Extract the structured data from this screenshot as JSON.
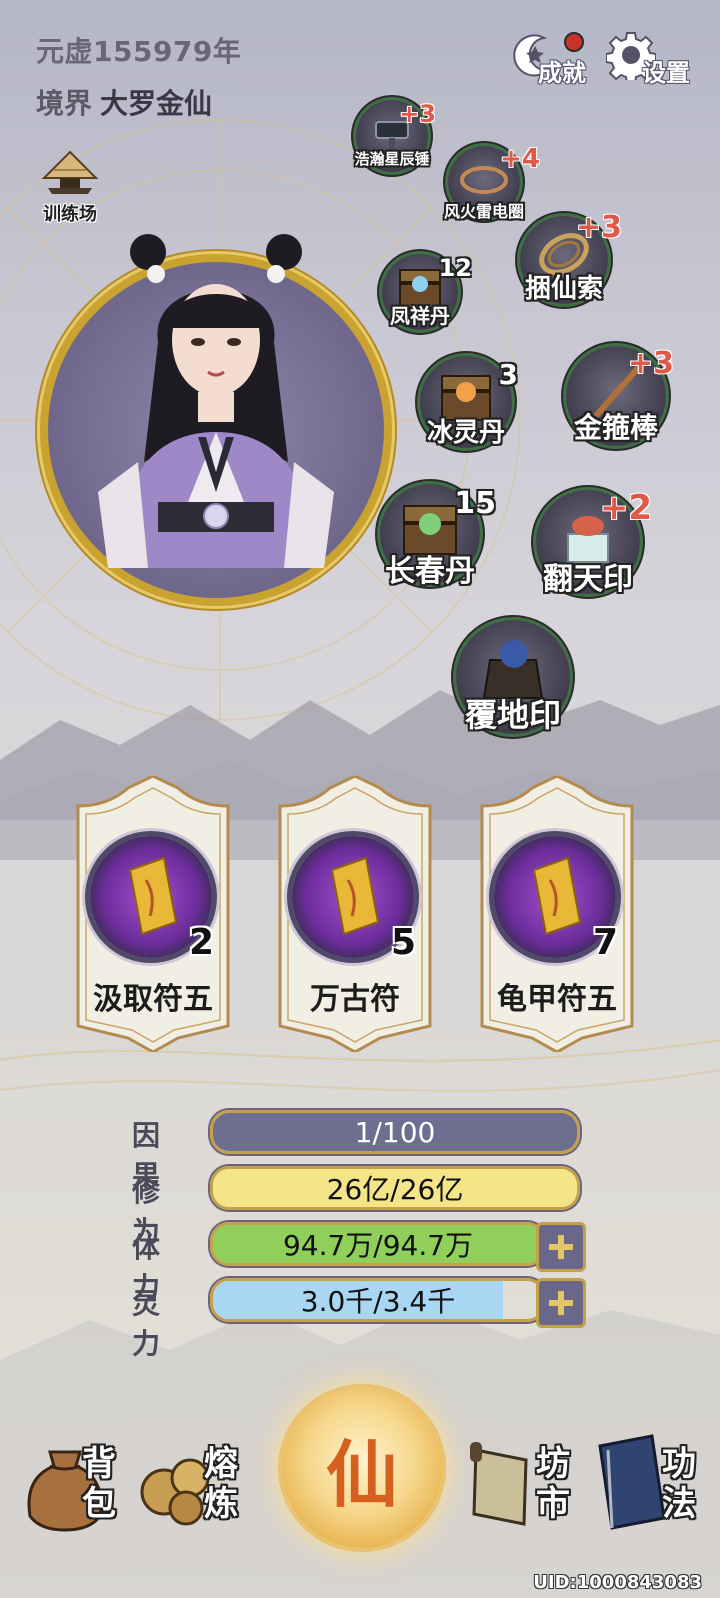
{
  "header": {
    "year": "元虚155979年",
    "realm_label": "境界",
    "realm_value": "大罗金仙",
    "achievement_label": "成就",
    "settings_label": "设置",
    "training_label": "训练场"
  },
  "items": [
    {
      "name": "浩瀚星辰锤",
      "badge": "+3"
    },
    {
      "name": "风火雷电圈",
      "badge": "+4"
    },
    {
      "name": "捆仙索",
      "badge": "+3"
    },
    {
      "name": "凤祥丹",
      "badge": "12"
    },
    {
      "name": "冰灵丹",
      "badge": "3"
    },
    {
      "name": "金箍棒",
      "badge": "+3"
    },
    {
      "name": "长春丹",
      "badge": "15"
    },
    {
      "name": "翻天印",
      "badge": "+2"
    },
    {
      "name": "覆地印",
      "badge": ""
    }
  ],
  "talismans": [
    {
      "name": "汲取符五",
      "count": "2"
    },
    {
      "name": "万古符",
      "count": "5"
    },
    {
      "name": "龟甲符五",
      "count": "7"
    }
  ],
  "stats": [
    {
      "label": "因果",
      "value": "1/100",
      "fill": 1.0,
      "color": "#6e6e90"
    },
    {
      "label": "修为",
      "value": "26亿/26亿",
      "fill": 1.0,
      "color": "#f5e589"
    },
    {
      "label": "体力",
      "value": "94.7万/94.7万",
      "fill": 1.0,
      "color": "#8fcf5a"
    },
    {
      "label": "灵力",
      "value": "3.0千/3.4千",
      "fill": 0.88,
      "color": "#a9d6f2"
    }
  ],
  "nav": {
    "bag": "背包",
    "smelt": "熔炼",
    "center": "仙",
    "market": "坊市",
    "skills": "功法"
  },
  "uid": "UID:1000843083"
}
